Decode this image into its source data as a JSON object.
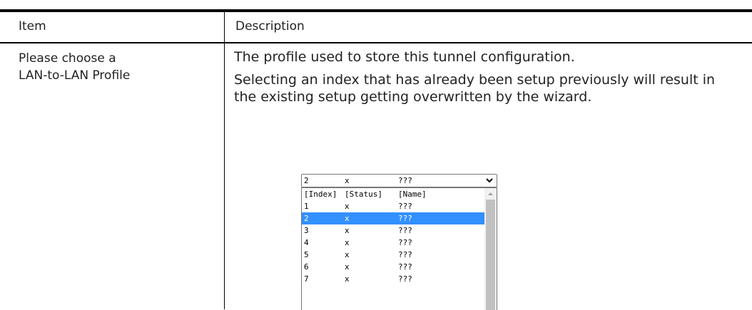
{
  "table": {
    "header": {
      "item": "Item",
      "description": "Description"
    },
    "row": {
      "item_lines": [
        "Please choose a",
        "LAN-to-LAN Profile"
      ],
      "description_paragraphs": [
        "The profile used to store this tunnel configuration.",
        "Selecting an index that has already been setup previously will result in the existing setup getting overwritten by the wizard."
      ]
    }
  },
  "dropdown": {
    "selected": {
      "index": "2",
      "status": "x",
      "name": "???"
    },
    "header": {
      "index": "[Index]",
      "status": "[Status]",
      "name": "[Name]"
    },
    "options": [
      {
        "index": "1",
        "status": "x",
        "name": "???"
      },
      {
        "index": "2",
        "status": "x",
        "name": "???",
        "selected": true
      },
      {
        "index": "3",
        "status": "x",
        "name": "???"
      },
      {
        "index": "4",
        "status": "x",
        "name": "???"
      },
      {
        "index": "5",
        "status": "x",
        "name": "???"
      },
      {
        "index": "6",
        "status": "x",
        "name": "???"
      },
      {
        "index": "7",
        "status": "x",
        "name": "???"
      }
    ],
    "arrow_icon": "chevron-down-icon",
    "scroll_up_icon": "scroll-up-icon",
    "highlight_color": "#3390ff"
  }
}
